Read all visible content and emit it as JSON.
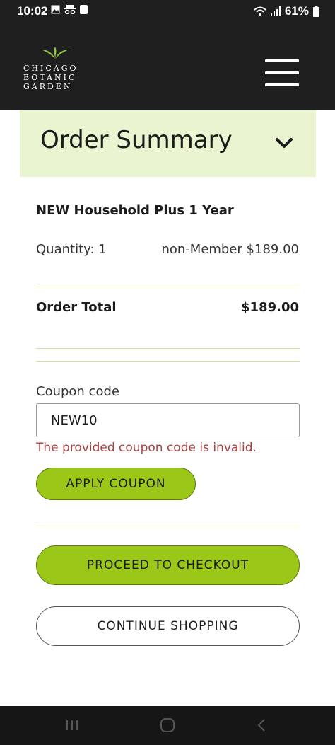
{
  "status_bar": {
    "time": "10:02",
    "battery": "61%",
    "left_icons": [
      "image-icon",
      "spy-icon",
      "sd-card-icon"
    ],
    "right_icons": [
      "wifi-icon",
      "signal-icon",
      "battery-icon"
    ]
  },
  "header": {
    "logo_text": "CHICAGO\nBOTANIC\nGARDEN",
    "logo_icon": "leaf-logo-icon",
    "menu_icon": "hamburger-menu-icon",
    "brand_green": "#8dc63f"
  },
  "summary": {
    "title": "Order Summary",
    "toggle_icon": "chevron-down-icon",
    "background": "#e8f5d0"
  },
  "order": {
    "product_name": "NEW Household Plus 1 Year",
    "quantity_label": "Quantity: 1",
    "quantity_price": "non-Member $189.00",
    "total_label": "Order Total",
    "total_value": "$189.00"
  },
  "coupon": {
    "label": "Coupon code",
    "value": "NEW10",
    "error": "The provided coupon code is invalid.",
    "apply_label": "APPLY COUPON"
  },
  "actions": {
    "checkout_label": "PROCEED TO CHECKOUT",
    "continue_label": "CONTINUE SHOPPING",
    "accent": "#9ac718"
  },
  "nav": {
    "icons": [
      "recent-apps-icon",
      "home-icon",
      "back-icon"
    ]
  }
}
